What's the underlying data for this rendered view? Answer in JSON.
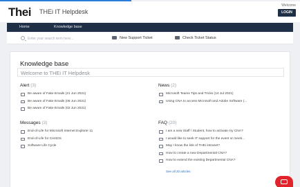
{
  "header": {
    "logo_text": "Thei",
    "site_title": "THEi IT Helpdesk",
    "welcome_text": "Welcome",
    "login_label": "LOGIN"
  },
  "nav": {
    "items": [
      {
        "label": "Home"
      },
      {
        "label": "Knowledge base"
      }
    ]
  },
  "toolbar": {
    "search_placeholder": "Enter your search term here...",
    "new_ticket_label": "New Support Ticket",
    "check_status_label": "Check Ticket Status"
  },
  "kb": {
    "title": "Knowledge base",
    "welcome": "Welcome to THEi IT Helpdesk"
  },
  "sections": {
    "alert": {
      "title": "Alert",
      "count": "(3)",
      "items": [
        "Be aware of Fake Emails (21 Jun 2021)",
        "Be aware of Fake Emails (08 Jun 2021)",
        "Be aware of Fake Emails (02 Jun 2021)"
      ]
    },
    "news": {
      "title": "News",
      "count": "(2)",
      "items": [
        "Microsoft Teams Tips and Tricks (14 Jul 2021)",
        "Using CNA to access Microsoft and Adobe Software (..."
      ]
    },
    "messages": {
      "title": "Messages",
      "count": "(3)",
      "items": [
        "End-of-Life for Microsoft Internet Explorer 11",
        "End-of-Life for CentOS",
        "Software Life Cycle"
      ]
    },
    "faq": {
      "title": "FAQ",
      "count": "(20)",
      "items": [
        "I am a new Staff / Student, how to activate my CNA?",
        "I would like to seek IT support for the event or meeti...",
        "May I know the link of THEi intranet?",
        "How to create a new Departmental CNA?",
        "How to extend the existing Departmental CNA?"
      ],
      "see_all": "See all 20 articles"
    }
  },
  "colors": {
    "accent_red": "#e0242c",
    "nav_bg": "#1f2f45",
    "link_blue": "#2b6fc7"
  }
}
